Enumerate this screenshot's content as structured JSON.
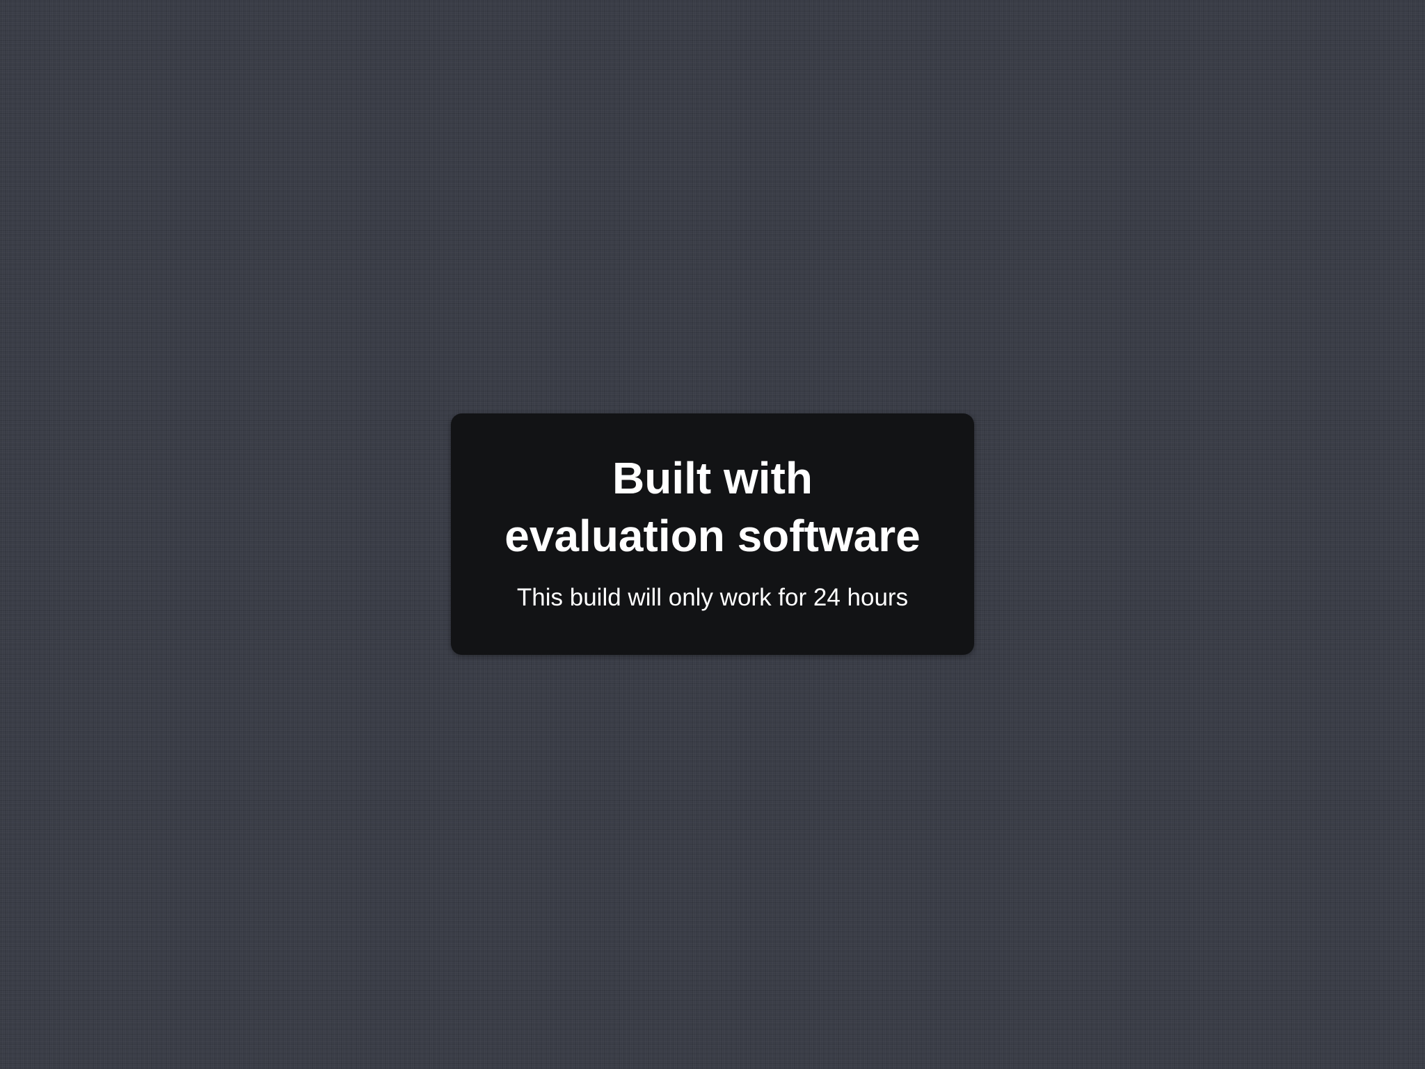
{
  "notice": {
    "title_line_1": "Built with",
    "title_line_2": "evaluation software",
    "subtitle": "This build will only work for 24 hours"
  },
  "colors": {
    "background": "#3a3d47",
    "card": "#121315",
    "text": "#ffffff"
  }
}
